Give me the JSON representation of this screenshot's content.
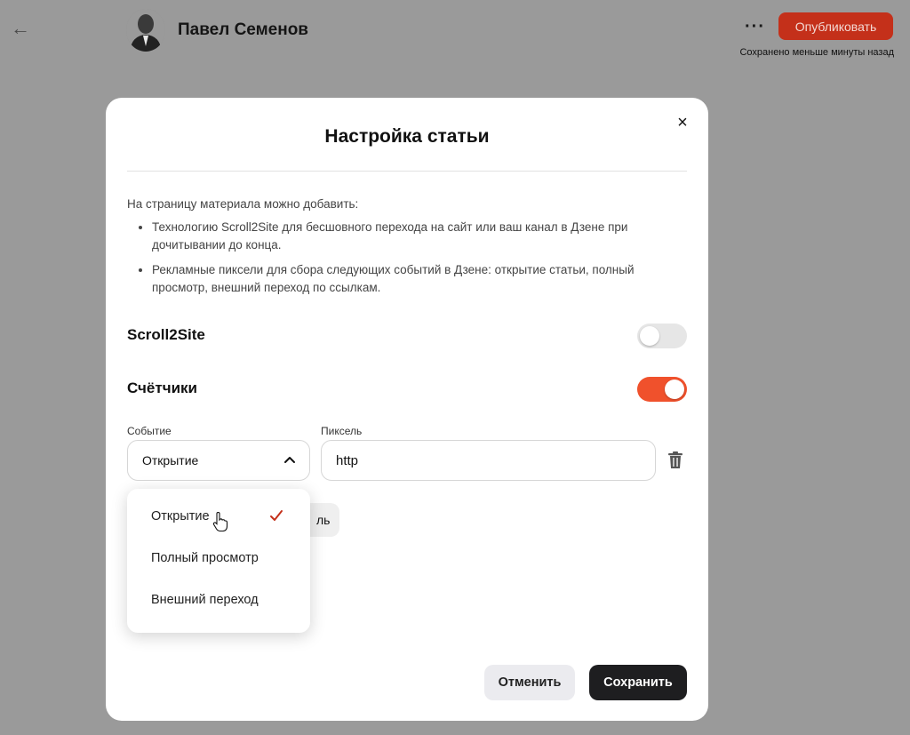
{
  "header": {
    "back_icon": "arrow-left-icon",
    "author_name": "Павел Семенов",
    "more_label": "···",
    "publish_label": "Опубликовать",
    "saved_status": "Сохранено меньше минуты назад",
    "publish_color": "#c4301a"
  },
  "modal": {
    "title": "Настройка статьи",
    "close_label": "×",
    "intro": "На страницу материала можно добавить:",
    "features": [
      "Технологию Scroll2Site для бесшовного перехода на сайт или ваш канал в Дзене при дочитывании до конца.",
      "Рекламные пиксели для сбора следующих событий в Дзене: открытие статьи, полный просмотр, внешний переход по ссылкам."
    ],
    "scroll2site": {
      "label": "Scroll2Site",
      "enabled": false
    },
    "counters": {
      "label": "Счётчики",
      "enabled": true,
      "accent_color": "#f0512c"
    },
    "event_field": {
      "label": "Событие",
      "value": "Открытие"
    },
    "pixel_field": {
      "label": "Пиксель",
      "value": "http"
    },
    "add_pixel_label": "ль",
    "dropdown": {
      "options": [
        "Открытие",
        "Полный просмотр",
        "Внешний переход"
      ],
      "selected": "Открытие"
    },
    "cancel_label": "Отменить",
    "save_label": "Сохранить"
  }
}
